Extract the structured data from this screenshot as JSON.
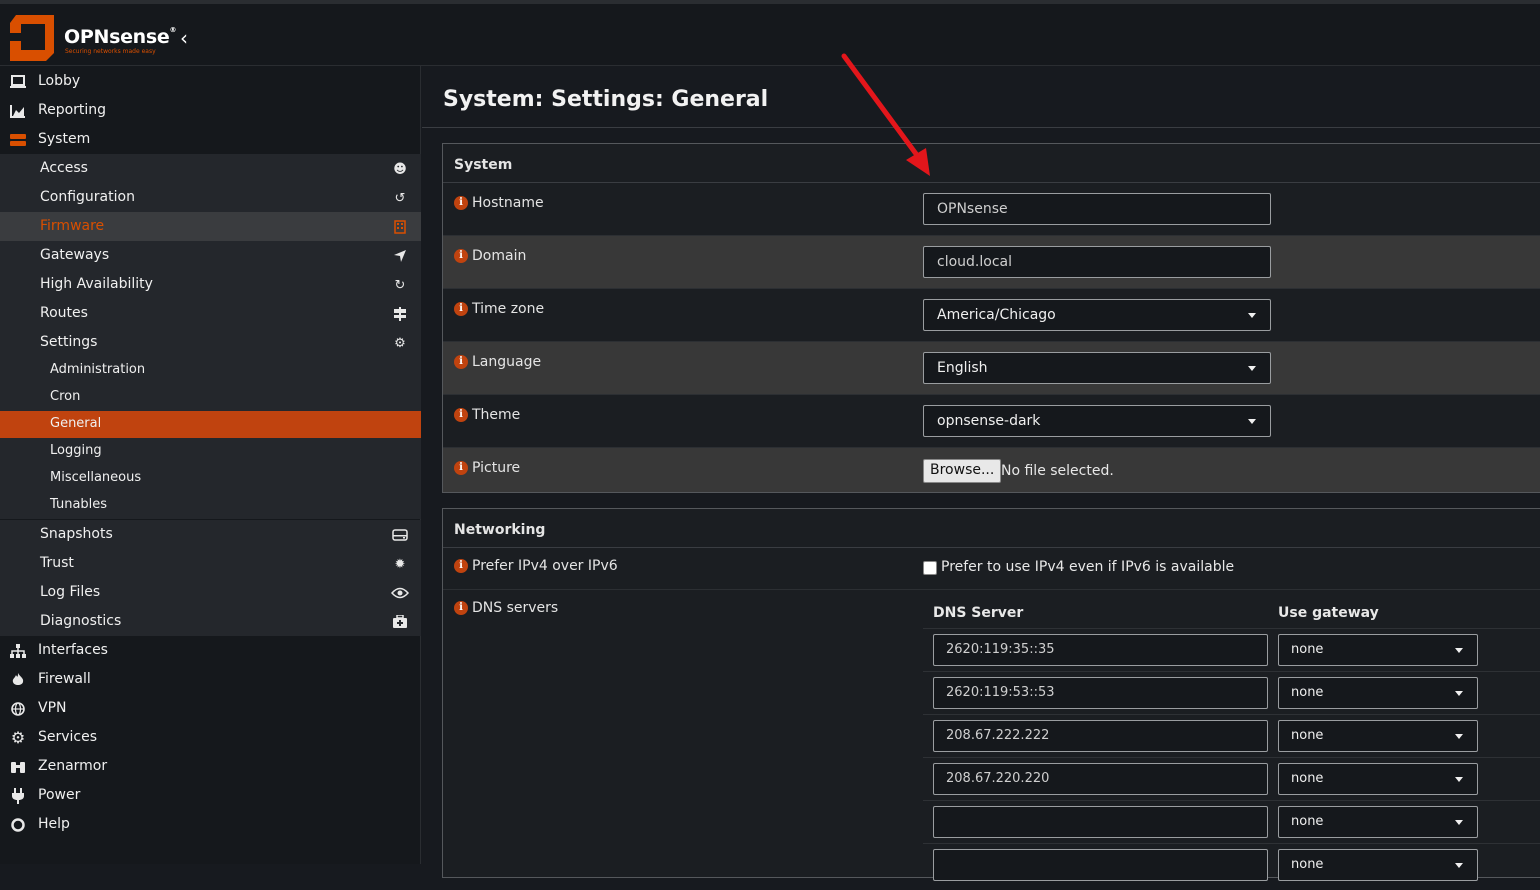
{
  "brand": {
    "name": "OPNsense",
    "reg": "®",
    "tagline": "Securing networks made easy",
    "accent": "#d94f00"
  },
  "sidebar": {
    "top": [
      {
        "label": "Lobby",
        "icon": "laptop-icon"
      },
      {
        "label": "Reporting",
        "icon": "area-chart-icon"
      },
      {
        "label": "System",
        "icon": "server-icon"
      }
    ],
    "system_items": [
      {
        "label": "Access",
        "icon": "users-icon"
      },
      {
        "label": "Configuration",
        "icon": "history-icon"
      },
      {
        "label": "Firmware",
        "icon": "building-icon"
      },
      {
        "label": "Gateways",
        "icon": "location-arrow-icon"
      },
      {
        "label": "High Availability",
        "icon": "refresh-icon"
      },
      {
        "label": "Routes",
        "icon": "signs-icon"
      },
      {
        "label": "Settings",
        "icon": "cogs-icon"
      }
    ],
    "settings_items": [
      {
        "label": "Administration"
      },
      {
        "label": "Cron"
      },
      {
        "label": "General"
      },
      {
        "label": "Logging"
      },
      {
        "label": "Miscellaneous"
      },
      {
        "label": "Tunables"
      }
    ],
    "system_items2": [
      {
        "label": "Snapshots",
        "icon": "hdd-icon"
      },
      {
        "label": "Trust",
        "icon": "certificate-icon"
      },
      {
        "label": "Log Files",
        "icon": "eye-icon"
      },
      {
        "label": "Diagnostics",
        "icon": "medkit-icon"
      }
    ],
    "bottom": [
      {
        "label": "Interfaces",
        "icon": "sitemap-icon"
      },
      {
        "label": "Firewall",
        "icon": "fire-icon"
      },
      {
        "label": "VPN",
        "icon": "globe-icon"
      },
      {
        "label": "Services",
        "icon": "cog-icon"
      },
      {
        "label": "Zenarmor",
        "icon": "binoculars-icon"
      },
      {
        "label": "Power",
        "icon": "plug-icon"
      },
      {
        "label": "Help",
        "icon": "life-ring-icon"
      }
    ]
  },
  "page": {
    "title": "System: Settings: General"
  },
  "system_panel": {
    "heading": "System",
    "hostname": {
      "label": "Hostname",
      "value": "OPNsense"
    },
    "domain": {
      "label": "Domain",
      "value": "cloud.local"
    },
    "timezone": {
      "label": "Time zone",
      "value": "America/Chicago"
    },
    "language": {
      "label": "Language",
      "value": "English"
    },
    "theme": {
      "label": "Theme",
      "value": "opnsense-dark"
    },
    "picture": {
      "label": "Picture",
      "button": "Browse...",
      "status": "No file selected."
    }
  },
  "networking_panel": {
    "heading": "Networking",
    "prefer_ipv4": {
      "label": "Prefer IPv4 over IPv6",
      "checkbox_label": "Prefer to use IPv4 even if IPv6 is available"
    },
    "dns": {
      "label": "DNS servers",
      "col_server": "DNS Server",
      "col_gateway": "Use gateway",
      "rows": [
        {
          "server": "2620:119:35::35",
          "gateway": "none"
        },
        {
          "server": "2620:119:53::53",
          "gateway": "none"
        },
        {
          "server": "208.67.222.222",
          "gateway": "none"
        },
        {
          "server": "208.67.220.220",
          "gateway": "none"
        },
        {
          "server": "",
          "gateway": "none"
        },
        {
          "server": "",
          "gateway": "none"
        }
      ]
    }
  }
}
